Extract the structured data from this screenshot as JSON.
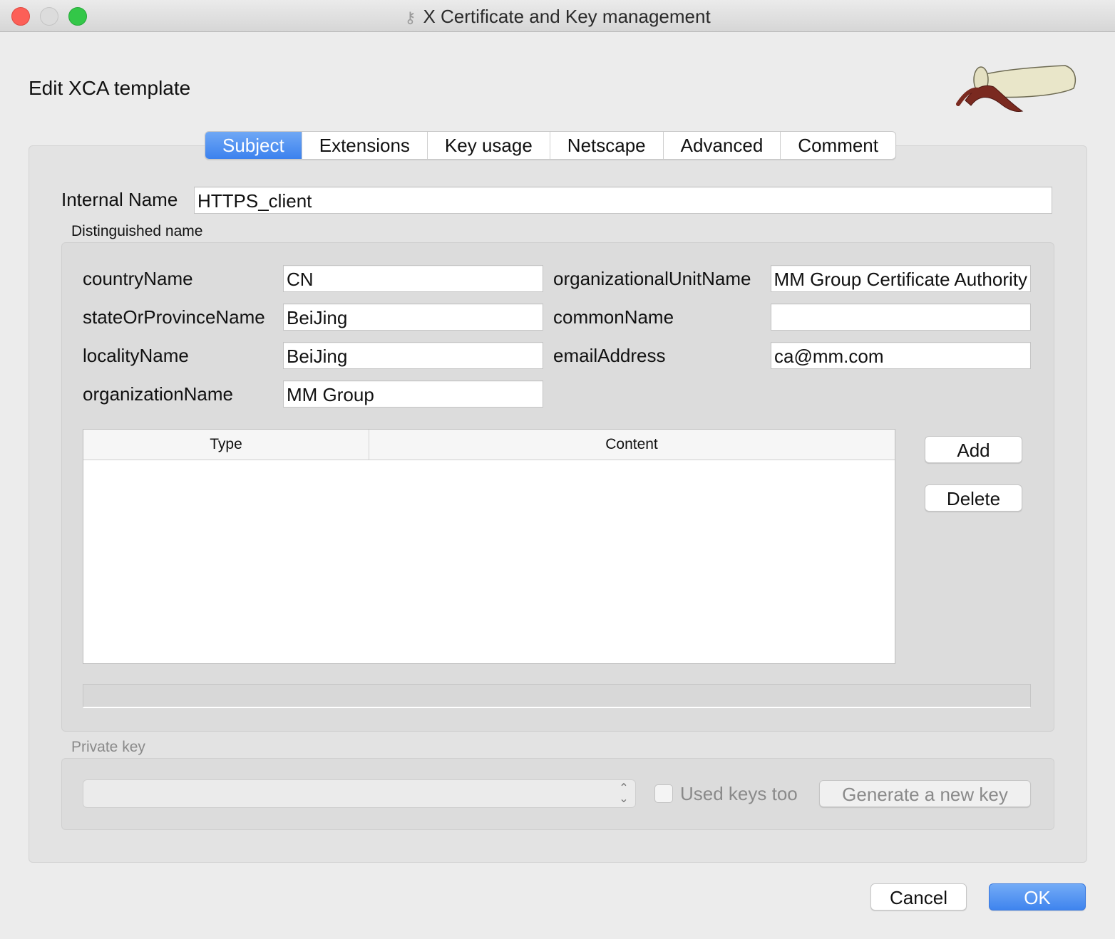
{
  "window": {
    "title": "X Certificate and Key management",
    "heading": "Edit XCA template"
  },
  "tabs": [
    {
      "label": "Subject",
      "active": true
    },
    {
      "label": "Extensions",
      "active": false
    },
    {
      "label": "Key usage",
      "active": false
    },
    {
      "label": "Netscape",
      "active": false
    },
    {
      "label": "Advanced",
      "active": false
    },
    {
      "label": "Comment",
      "active": false
    }
  ],
  "internal_name": {
    "label": "Internal Name",
    "value": "HTTPS_client"
  },
  "distinguished_name": {
    "title": "Distinguished name",
    "country": {
      "label": "countryName",
      "value": "CN"
    },
    "state": {
      "label": "stateOrProvinceName",
      "value": "BeiJing"
    },
    "locality": {
      "label": "localityName",
      "value": "BeiJing"
    },
    "organization": {
      "label": "organizationName",
      "value": "MM Group"
    },
    "org_unit": {
      "label": "organizationalUnitName",
      "value": "MM Group Certificate Authority"
    },
    "common_name": {
      "label": "commonName",
      "value": ""
    },
    "email": {
      "label": "emailAddress",
      "value": "ca@mm.com"
    },
    "table": {
      "columns": [
        "Type",
        "Content"
      ],
      "rows": []
    },
    "add_label": "Add",
    "delete_label": "Delete"
  },
  "private_key": {
    "title": "Private key",
    "selected": "",
    "used_keys_label": "Used keys too",
    "used_keys_checked": false,
    "generate_label": "Generate a new key"
  },
  "footer": {
    "cancel_label": "Cancel",
    "ok_label": "OK"
  },
  "colors": {
    "accent": "#3c82ee",
    "close": "#fc5f57",
    "maximize": "#33c748"
  }
}
